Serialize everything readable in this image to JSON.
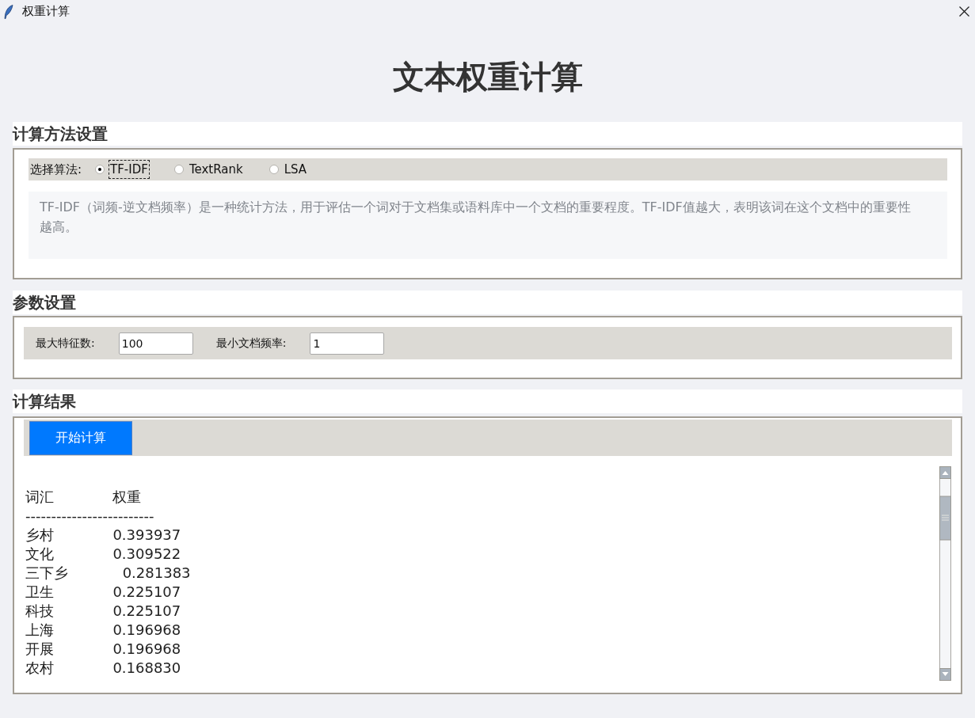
{
  "window": {
    "title": "权重计算"
  },
  "heading": "文本权重计算",
  "method_section": {
    "title": "计算方法设置",
    "label": "选择算法:",
    "algorithms": [
      {
        "label": "TF-IDF",
        "selected": true
      },
      {
        "label": "TextRank",
        "selected": false
      },
      {
        "label": "LSA",
        "selected": false
      }
    ],
    "description": "TF-IDF（词频-逆文档频率）是一种统计方法，用于评估一个词对于文档集或语料库中一个文档的重要程度。TF-IDF值越大，表明该词在这个文档中的重要性越高。"
  },
  "params_section": {
    "title": "参数设置",
    "fields": [
      {
        "label": "最大特征数:",
        "value": "100"
      },
      {
        "label": "最小文档频率:",
        "value": "1"
      }
    ]
  },
  "results_section": {
    "title": "计算结果",
    "button": "开始计算",
    "output_lines": [
      "词汇             权重",
      "-------------------------",
      "乡村             0.393937",
      "文化             0.309522",
      "三下乡            0.281383",
      "卫生             0.225107",
      "科技             0.225107",
      "上海             0.196968",
      "开展             0.196968",
      "农村             0.168830"
    ]
  }
}
